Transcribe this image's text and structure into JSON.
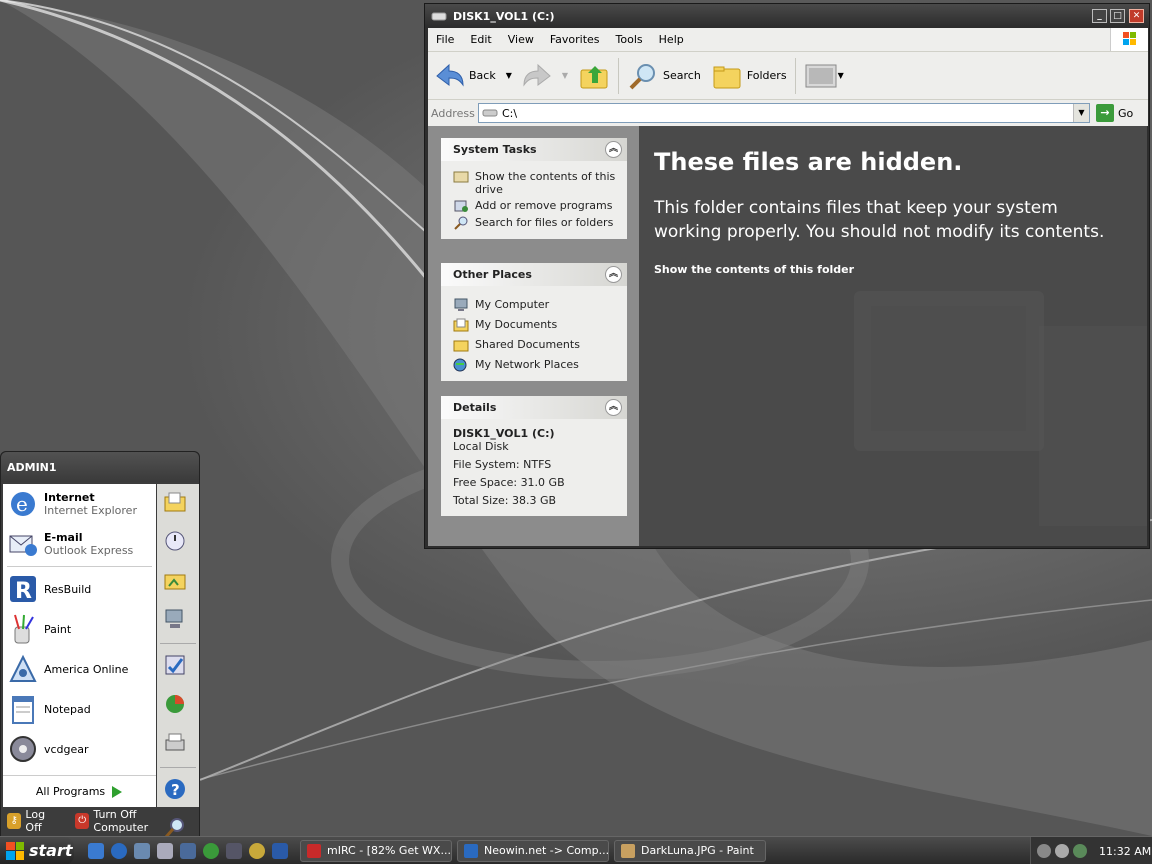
{
  "window": {
    "title": "DISK1_VOL1 (C:)",
    "menu": [
      {
        "label": "File"
      },
      {
        "label": "Edit"
      },
      {
        "label": "View"
      },
      {
        "label": "Favorites"
      },
      {
        "label": "Tools"
      },
      {
        "label": "Help"
      }
    ],
    "toolbar": {
      "back": "Back",
      "search": "Search",
      "folders": "Folders"
    },
    "address": {
      "label": "Address",
      "value": "C:\\",
      "go": "Go"
    }
  },
  "tasks": {
    "system": {
      "title": "System Tasks",
      "items": [
        {
          "label": "Show the contents of this drive",
          "icon": "show-contents-icon"
        },
        {
          "label": "Add or remove programs",
          "icon": "add-remove-icon"
        },
        {
          "label": "Search for files or folders",
          "icon": "search-icon"
        }
      ]
    },
    "places": {
      "title": "Other Places",
      "items": [
        {
          "label": "My Computer",
          "icon": "computer-icon"
        },
        {
          "label": "My Documents",
          "icon": "documents-icon"
        },
        {
          "label": "Shared Documents",
          "icon": "folder-icon"
        },
        {
          "label": "My Network Places",
          "icon": "network-icon"
        }
      ]
    },
    "details": {
      "title": "Details",
      "name": "DISK1_VOL1 (C:)",
      "type": "Local Disk",
      "filesystem": "File System: NTFS",
      "free": "Free Space: 31.0 GB",
      "total": "Total Size: 38.3 GB"
    }
  },
  "content": {
    "heading": "These files are hidden.",
    "message": "This folder contains files that keep your system working properly. You should not modify its contents.",
    "link": "Show the contents of this folder"
  },
  "startmenu": {
    "user": "ADMIN1",
    "pinned": [
      {
        "title": "Internet",
        "subtitle": "Internet Explorer"
      },
      {
        "title": "E-mail",
        "subtitle": "Outlook Express"
      }
    ],
    "recent": [
      {
        "label": "ResBuild"
      },
      {
        "label": "Paint"
      },
      {
        "label": "America Online"
      },
      {
        "label": "Notepad"
      },
      {
        "label": "vcdgear"
      }
    ],
    "all_programs": "All Programs",
    "log_off": "Log Off",
    "turn_off": "Turn Off Computer"
  },
  "taskbar": {
    "start": "start",
    "tasks": [
      {
        "label": "mIRC - [82% Get WX..."
      },
      {
        "label": "Neowin.net -> Comp..."
      },
      {
        "label": "DarkLuna.JPG - Paint"
      }
    ],
    "clock": "11:32 AM"
  },
  "colors": {
    "desktop": "#6c6c6c",
    "content_bg": "#4a4a4a",
    "panel_bg": "#eeeeec"
  }
}
